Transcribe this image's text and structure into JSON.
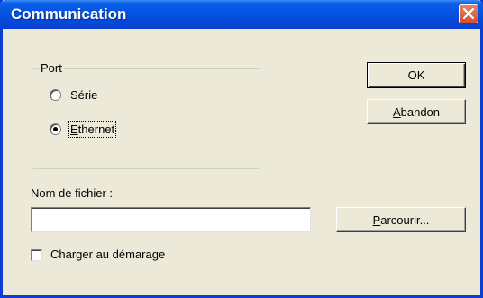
{
  "window": {
    "title": "Communication"
  },
  "port": {
    "legend": "Port",
    "options": [
      {
        "label": "Série",
        "selected": false
      },
      {
        "label": "Ethernet",
        "selected": true
      }
    ]
  },
  "buttons": {
    "ok": "OK",
    "abandon": {
      "accel": "A",
      "rest": "bandon"
    },
    "parcourir": {
      "accel": "P",
      "rest": "arcourir..."
    }
  },
  "file": {
    "label": "Nom de fichier :",
    "value": ""
  },
  "startup": {
    "label": "Charger au démarage",
    "checked": false
  },
  "colors": {
    "titlebar": "#0a5ee8",
    "close": "#d3502e",
    "face": "#ece9d8"
  }
}
